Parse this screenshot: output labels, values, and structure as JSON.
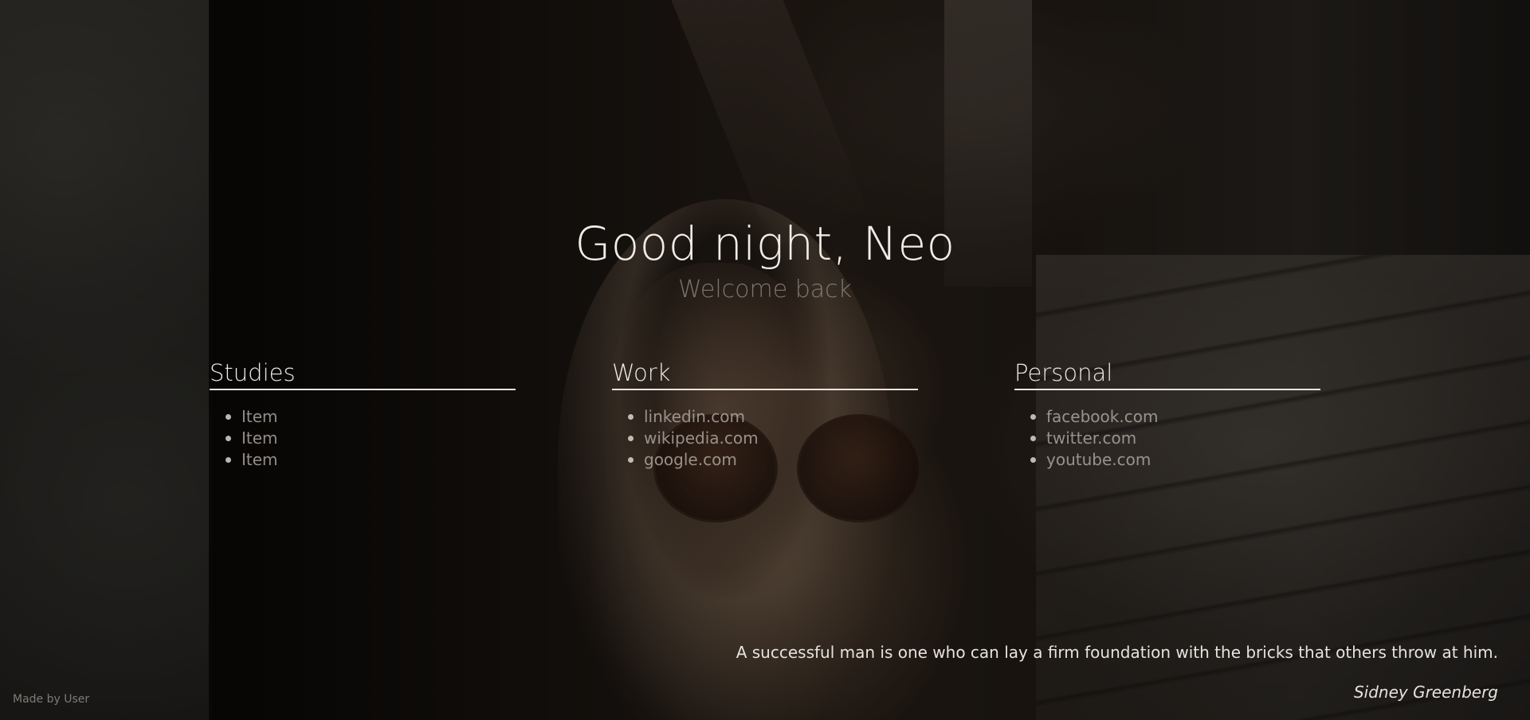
{
  "header": {
    "greeting": "Good night, Neo",
    "subtitle": "Welcome back"
  },
  "columns": [
    {
      "title": "Studies",
      "items": [
        "Item",
        "Item",
        "Item"
      ]
    },
    {
      "title": "Work",
      "items": [
        "linkedin.com",
        "wikipedia.com",
        "google.com"
      ]
    },
    {
      "title": "Personal",
      "items": [
        "facebook.com",
        "twitter.com",
        "youtube.com"
      ]
    }
  ],
  "quote": {
    "text": "A successful man is one who can lay a firm foundation with the bricks that others throw at him.",
    "author": "Sidney Greenberg"
  },
  "footer": {
    "credit": "Made by User"
  },
  "colors": {
    "heading": "#f0ece8",
    "link": "#b9b2aa",
    "divider": "#e8e4e0"
  }
}
